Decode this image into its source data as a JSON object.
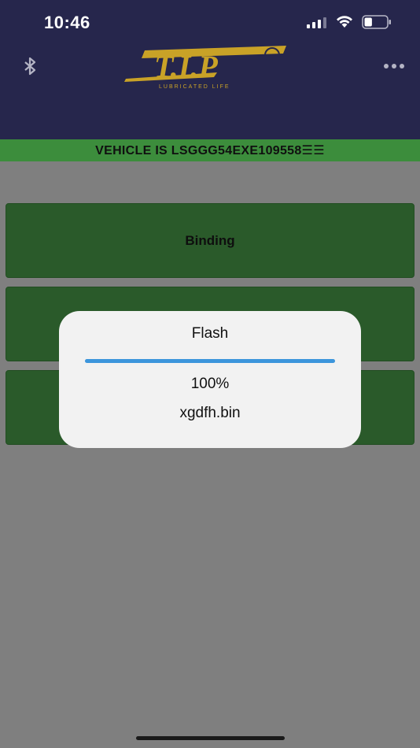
{
  "status_bar": {
    "time": "10:46",
    "signal_icon": "cellular-signal-icon",
    "wifi_icon": "wifi-icon",
    "battery_icon": "battery-icon",
    "battery_level": 0.35
  },
  "header": {
    "bluetooth_icon": "bluetooth-icon",
    "logo_text": "T.I.P",
    "logo_tagline": "LUBRICATED LIFE",
    "more_icon": "more-dots-icon",
    "background_color": "#26264c",
    "logo_color": "#c9a227"
  },
  "vehicle_bar": {
    "text": "VEHICLE IS LSGGG54EXE109558☰☰",
    "background_color": "#3c8d3c"
  },
  "menu": {
    "items": [
      {
        "label": "Binding"
      },
      {
        "label": ""
      },
      {
        "label": ""
      }
    ],
    "button_color": "#2a5a2a"
  },
  "dialog": {
    "title": "Flash",
    "progress": 1.0,
    "percent_text": "100%",
    "filename": "xgdfh.bin",
    "progress_color": "#3c96dc"
  }
}
